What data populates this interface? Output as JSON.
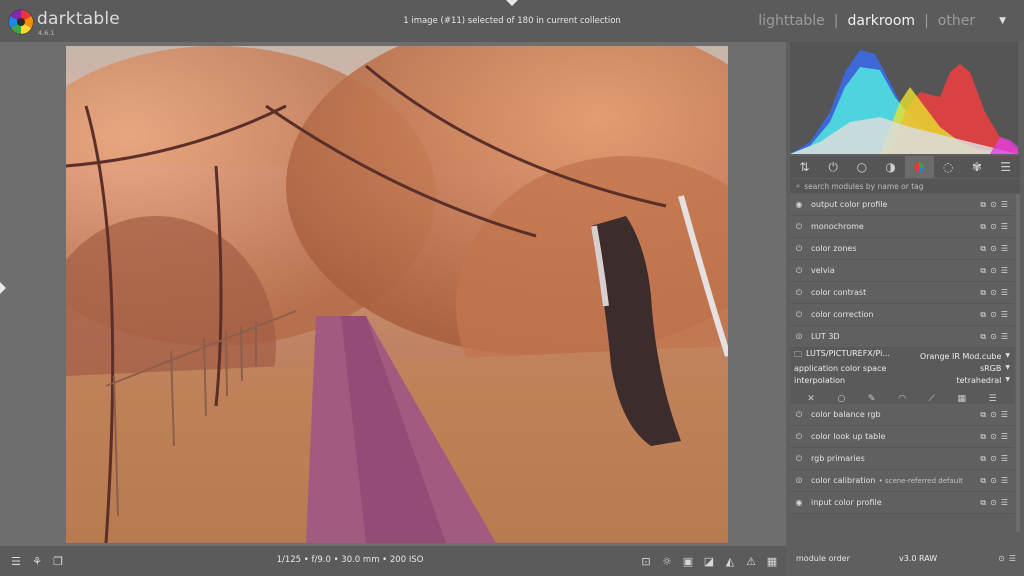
{
  "app": {
    "brand": "darktable",
    "version": "4.6.1"
  },
  "header": {
    "status": "1 image (#11) selected of 180 in current collection",
    "views": [
      {
        "label": "lighttable",
        "active": false
      },
      {
        "label": "darkroom",
        "active": true
      },
      {
        "label": "other",
        "active": false
      }
    ],
    "dropdown_icon": "chevron-down-icon"
  },
  "footer": {
    "exif": "1/125 • f/9.0 • 30.0 mm • 200 ISO",
    "left_icons": [
      "hamburger-icon",
      "presets-icon",
      "duplicate-icon"
    ],
    "right_icons": [
      "focus-peaking-icon",
      "lightbulb-icon",
      "gamut-check-icon",
      "softproof-icon",
      "guides-icon",
      "overexposed-icon",
      "rawoverexposed-icon",
      "second-window-icon"
    ]
  },
  "panel": {
    "tabs": [
      "quick-access-icon",
      "active-modules-icon",
      "base-icon",
      "tone-icon",
      "color-icon",
      "correct-icon",
      "effect-icon",
      "menu-icon"
    ],
    "search_placeholder": "search modules by name or tag",
    "modules_top": [
      {
        "label": "output color profile",
        "sub": ""
      },
      {
        "label": "monochrome",
        "sub": ""
      },
      {
        "label": "color zones",
        "sub": ""
      },
      {
        "label": "velvia",
        "sub": ""
      },
      {
        "label": "color contrast",
        "sub": ""
      },
      {
        "label": "color correction",
        "sub": ""
      },
      {
        "label": "LUT 3D",
        "sub": ""
      }
    ],
    "lut": {
      "file_path": "LUTS/PICTUREFX/Pi...",
      "file_name": "Orange IR Mod.cube",
      "color_space_label": "application color space",
      "color_space_value": "sRGB",
      "interpolation_label": "interpolation",
      "interpolation_value": "tetrahedral"
    },
    "modules_bottom": [
      {
        "label": "color balance rgb",
        "sub": ""
      },
      {
        "label": "color look up table",
        "sub": ""
      },
      {
        "label": "rgb primaries",
        "sub": ""
      },
      {
        "label": "color calibration",
        "sub": "• scene-referred default"
      },
      {
        "label": "input color profile",
        "sub": ""
      }
    ],
    "module_order_label": "module order",
    "module_order_value": "v3.0 RAW"
  },
  "colors": {
    "chrome": "#5b5b5b",
    "background": "#6e6e6e",
    "panel": "#5f5f5f",
    "text": "#e8e8e8",
    "histogram_blue": "#3b6cf0",
    "histogram_cyan": "#4fe0e0",
    "histogram_red": "#f04040",
    "histogram_yellow": "#e8e030",
    "histogram_magenta": "#e040e0"
  }
}
